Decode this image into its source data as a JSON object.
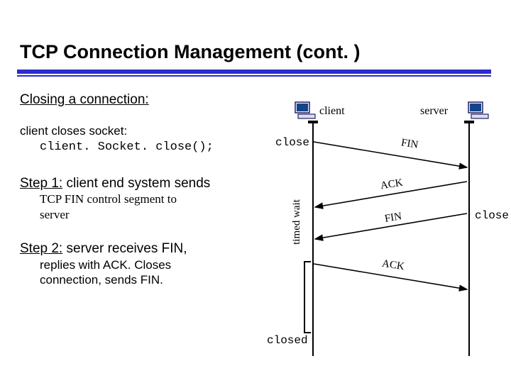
{
  "title": "TCP Connection Management (cont. )",
  "closing_heading": "Closing a connection:",
  "client_closes_line": "client closes socket:",
  "client_closes_code": "client. Socket. close();",
  "step1_label": "Step 1:",
  "step1_tail": " client end system sends",
  "step1_body_a": "TCP FIN control segment to",
  "step1_body_b": "server",
  "step2_label": "Step 2:",
  "step2_tail": " server receives FIN,",
  "step2_body_a": "replies with ACK. Closes",
  "step2_body_b": "connection, sends FIN.",
  "diagram": {
    "client_label": "client",
    "server_label": "server",
    "close_left": "close",
    "close_right": "close",
    "closed": "closed",
    "timed_wait": "timed wait",
    "msg_fin1": "FIN",
    "msg_ack1": "ACK",
    "msg_fin2": "FIN",
    "msg_ack2": "ACK"
  }
}
